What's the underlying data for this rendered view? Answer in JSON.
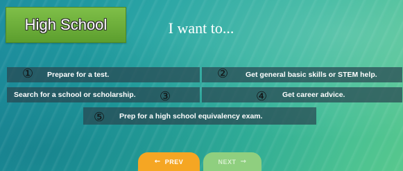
{
  "badge": {
    "label": "High School"
  },
  "heading": "I want to...",
  "options": [
    {
      "number": "①",
      "label": "Prepare for a test."
    },
    {
      "number": "②",
      "label": "Get general basic skills or STEM help."
    },
    {
      "number": "③",
      "label": "Search for a school or scholarship."
    },
    {
      "number": "④",
      "label": "Get career advice."
    },
    {
      "number": "⑤",
      "label": "Prep for a high school equivalency exam."
    }
  ],
  "nav": {
    "prev_arrow": "←",
    "prev_label": "PREV",
    "next_label": "NEXT",
    "next_arrow": "→",
    "next_enabled": false
  },
  "colors": {
    "badge": "#6aaa38",
    "option_bg": "#28464f",
    "prev_button": "#f5a623",
    "next_button_disabled": "#8fcf7f"
  }
}
